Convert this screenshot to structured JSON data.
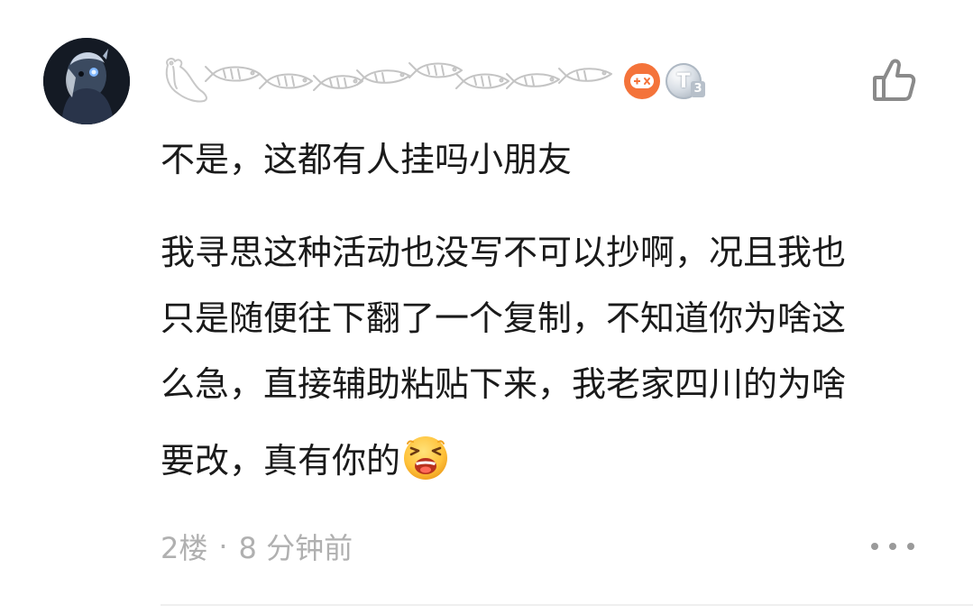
{
  "comment": {
    "avatar_icon": "avatar-image",
    "username_art_icon": "decorative-fish-username",
    "badges": {
      "game_icon": "game-controller-icon",
      "game_color": "#f4733a",
      "level_letter": "T",
      "level_number": "3"
    },
    "like_icon": "thumbs-up-icon",
    "text_lines_1": [
      "不是，这都有人挂吗小朋友"
    ],
    "text_lines_2": [
      "我寻思这种活动也没写不可以抄啊，况且我也",
      "只是随便往下翻了一个复制，不知道你为啥这",
      "么急，直接辅助粘贴下来，我老家四川的为啥",
      "要改，真有你的"
    ],
    "emoji_icon": "laughing-emoji-icon",
    "meta": {
      "floor": "2楼",
      "separator": "·",
      "time": "8 分钟前"
    },
    "more_icon": "more-dots-icon"
  },
  "colors": {
    "text": "#1a1a1a",
    "meta_text": "#b0b0b0",
    "divider": "#efefef",
    "accent_orange": "#f4733a"
  }
}
